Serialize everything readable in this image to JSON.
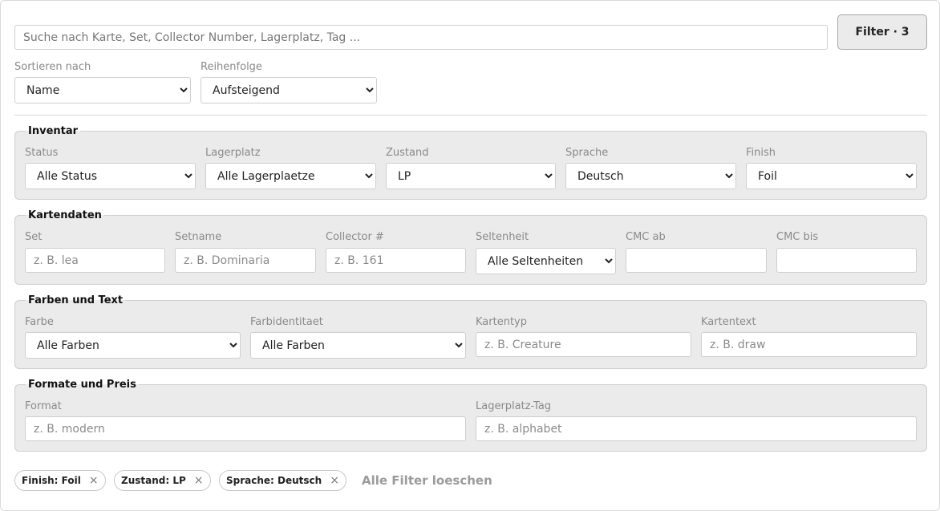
{
  "search": {
    "placeholder": "Suche nach Karte, Set, Collector Number, Lagerplatz, Tag ..."
  },
  "filter_button": {
    "label": "Filter · 3"
  },
  "sort": {
    "by_label": "Sortieren nach",
    "by_value": "Name",
    "order_label": "Reihenfolge",
    "order_value": "Aufsteigend"
  },
  "inventar": {
    "legend": "Inventar",
    "status_label": "Status",
    "status_value": "Alle Status",
    "lagerplatz_label": "Lagerplatz",
    "lagerplatz_value": "Alle Lagerplaetze",
    "zustand_label": "Zustand",
    "zustand_value": "LP",
    "sprache_label": "Sprache",
    "sprache_value": "Deutsch",
    "finish_label": "Finish",
    "finish_value": "Foil"
  },
  "kartendaten": {
    "legend": "Kartendaten",
    "set_label": "Set",
    "set_placeholder": "z. B. lea",
    "setname_label": "Setname",
    "setname_placeholder": "z. B. Dominaria",
    "collector_label": "Collector #",
    "collector_placeholder": "z. B. 161",
    "seltenheit_label": "Seltenheit",
    "seltenheit_value": "Alle Seltenheiten",
    "cmc_ab_label": "CMC ab",
    "cmc_bis_label": "CMC bis"
  },
  "farben": {
    "legend": "Farben und Text",
    "farbe_label": "Farbe",
    "farbe_value": "Alle Farben",
    "identitaet_label": "Farbidentitaet",
    "identitaet_value": "Alle Farben",
    "typ_label": "Kartentyp",
    "typ_placeholder": "z. B. Creature",
    "text_label": "Kartentext",
    "text_placeholder": "z. B. draw"
  },
  "formate": {
    "legend": "Formate und Preis",
    "format_label": "Format",
    "format_placeholder": "z. B. modern",
    "tag_label": "Lagerplatz-Tag",
    "tag_placeholder": "z. B. alphabet"
  },
  "active_filters": {
    "chips": [
      "Finish: Foil",
      "Zustand: LP",
      "Sprache: Deutsch"
    ],
    "remove_glyph": "×",
    "clear_all": "Alle Filter loeschen"
  }
}
